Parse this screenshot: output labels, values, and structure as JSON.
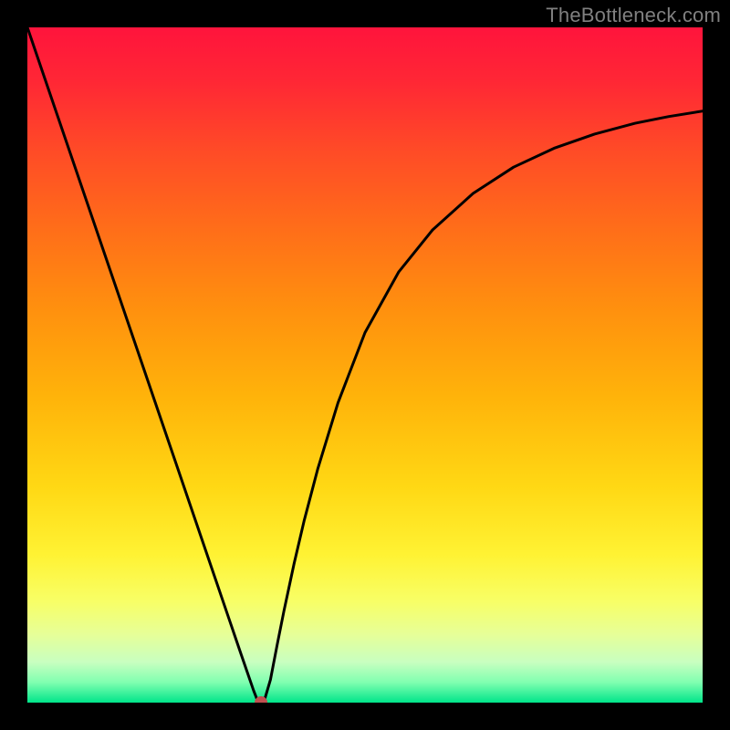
{
  "watermark": "TheBottleneck.com",
  "chart_data": {
    "type": "line",
    "title": "",
    "xlabel": "",
    "ylabel": "",
    "xlim": [
      0,
      100
    ],
    "ylim": [
      0,
      100
    ],
    "background_gradient": {
      "stops": [
        {
          "offset": 0.0,
          "color": "#ff143c"
        },
        {
          "offset": 0.08,
          "color": "#ff2735"
        },
        {
          "offset": 0.18,
          "color": "#ff4a27"
        },
        {
          "offset": 0.3,
          "color": "#ff6e19"
        },
        {
          "offset": 0.42,
          "color": "#ff910e"
        },
        {
          "offset": 0.55,
          "color": "#ffb40a"
        },
        {
          "offset": 0.68,
          "color": "#ffd814"
        },
        {
          "offset": 0.78,
          "color": "#fff233"
        },
        {
          "offset": 0.85,
          "color": "#f8ff66"
        },
        {
          "offset": 0.9,
          "color": "#e6ff99"
        },
        {
          "offset": 0.94,
          "color": "#c8ffc0"
        },
        {
          "offset": 0.97,
          "color": "#80ffb0"
        },
        {
          "offset": 1.0,
          "color": "#00e58a"
        }
      ]
    },
    "series": [
      {
        "name": "curve",
        "color": "#000000",
        "x": [
          0.0,
          3.0,
          6.0,
          9.0,
          12.0,
          15.0,
          18.0,
          21.0,
          24.0,
          27.0,
          30.0,
          31.5,
          32.5,
          33.5,
          34.2,
          35.0,
          36.0,
          37.0,
          38.0,
          39.5,
          41.0,
          43.0,
          46.0,
          50.0,
          55.0,
          60.0,
          66.0,
          72.0,
          78.0,
          84.0,
          90.0,
          95.0,
          100.0
        ],
        "y": [
          100.0,
          91.2,
          82.4,
          73.6,
          64.8,
          56.0,
          47.2,
          38.4,
          29.6,
          20.8,
          12.0,
          7.6,
          4.7,
          1.8,
          0.0,
          0.0,
          3.4,
          8.6,
          13.6,
          20.6,
          27.0,
          34.6,
          44.4,
          54.8,
          63.8,
          70.0,
          75.4,
          79.3,
          82.1,
          84.2,
          85.8,
          86.8,
          87.6
        ]
      }
    ],
    "marker": {
      "x": 34.6,
      "y": 0.0,
      "color": "#c05050",
      "radius_px": 7
    }
  }
}
